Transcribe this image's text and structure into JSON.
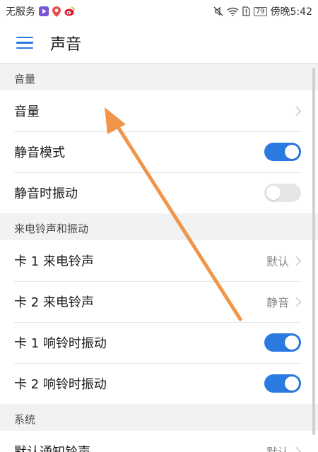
{
  "status_bar": {
    "carrier": "无服务",
    "battery": "79",
    "time": "傍晚5:42"
  },
  "app_bar": {
    "title": "声音"
  },
  "sections": [
    {
      "header": "音量",
      "rows": [
        {
          "label": "音量",
          "type": "link",
          "value": ""
        },
        {
          "label": "静音模式",
          "type": "toggle",
          "on": true
        },
        {
          "label": "静音时振动",
          "type": "toggle",
          "on": false
        }
      ]
    },
    {
      "header": "来电铃声和振动",
      "rows": [
        {
          "label": "卡 1 来电铃声",
          "type": "link",
          "value": "默认"
        },
        {
          "label": "卡 2 来电铃声",
          "type": "link",
          "value": "静音"
        },
        {
          "label": "卡 1 响铃时振动",
          "type": "toggle",
          "on": true
        },
        {
          "label": "卡 2 响铃时振动",
          "type": "toggle",
          "on": true
        }
      ]
    },
    {
      "header": "系统",
      "rows": [
        {
          "label": "默认通知铃声",
          "type": "link",
          "value": "默认"
        }
      ]
    }
  ],
  "colors": {
    "accent": "#2a7ae2",
    "annotation_arrow": "#f0954a"
  },
  "icons": [
    "play-app-icon",
    "map-pin-app-icon",
    "weibo-app-icon",
    "mute-icon",
    "wifi-icon",
    "sim-alert-icon",
    "battery-icon",
    "menu-icon",
    "chevron-right-icon"
  ]
}
